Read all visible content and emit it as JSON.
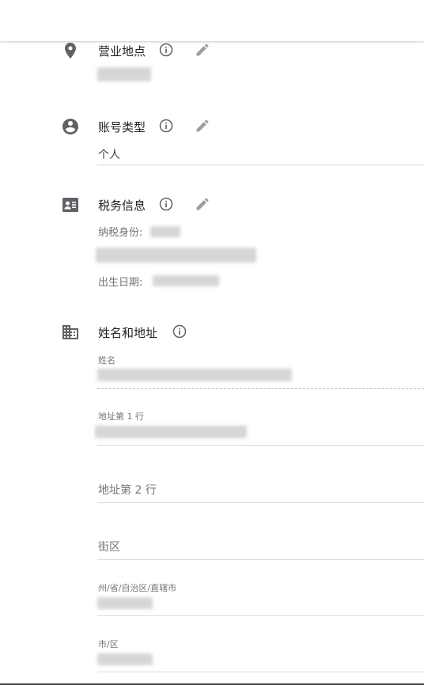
{
  "sections": {
    "business_location": {
      "title": "营业地点"
    },
    "account_type": {
      "title": "账号类型",
      "value": "个人"
    },
    "tax_info": {
      "title": "税务信息",
      "tax_status_label": "纳税身份:",
      "birth_date_label": "出生日期:"
    },
    "name_address": {
      "title": "姓名和地址"
    }
  },
  "form": {
    "name_label": "姓名",
    "address_line1_label": "地址第 1 行",
    "address_line2_placeholder": "地址第 2 行",
    "district_placeholder": "街区",
    "province_label": "州/省/自治区/直辖市",
    "city_label": "市/区"
  },
  "icons": {
    "location": "location-pin-icon",
    "account": "account-circle-icon",
    "tax": "contact-card-icon",
    "building": "business-building-icon",
    "info": "info-icon",
    "edit": "pencil-edit-icon"
  },
  "colors": {
    "icon": "#5f6368",
    "text": "#202124",
    "label": "#757575",
    "divider": "#dcdcdc"
  }
}
